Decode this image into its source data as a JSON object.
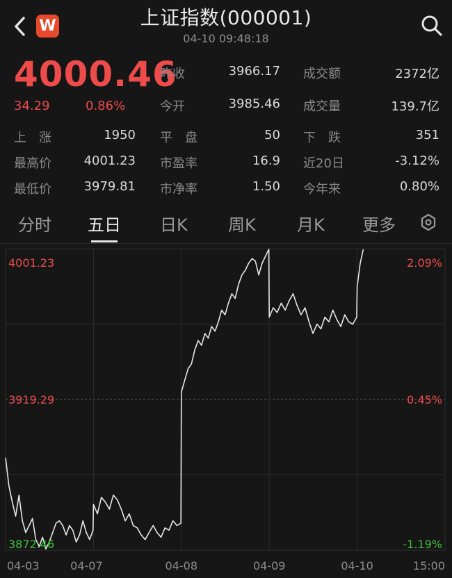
{
  "header": {
    "title": "上证指数(000001)",
    "timestamp": "04-10 09:48:18",
    "app_badge": "W"
  },
  "quote": {
    "price": "4000.46",
    "change": "34.29",
    "change_pct": "0.86%",
    "stats": [
      {
        "label": "昨收",
        "value": "3966.17"
      },
      {
        "label": "成交额",
        "value": "2372亿"
      },
      {
        "label": "今开",
        "value": "3985.46"
      },
      {
        "label": "成交量",
        "value": "139.7亿"
      },
      {
        "label": "上　涨",
        "value": "1950"
      },
      {
        "label": "平　盘",
        "value": "50"
      },
      {
        "label": "下　跌",
        "value": "351"
      },
      {
        "label": "最高价",
        "value": "4001.23"
      },
      {
        "label": "市盈率",
        "value": "16.9"
      },
      {
        "label": "近20日",
        "value": "-3.12%"
      },
      {
        "label": "最低价",
        "value": "3979.81"
      },
      {
        "label": "市净率",
        "value": "1.50"
      },
      {
        "label": "今年来",
        "value": "0.80%"
      }
    ]
  },
  "tabs": [
    {
      "label": "分时"
    },
    {
      "label": "五日"
    },
    {
      "label": "日K"
    },
    {
      "label": "周K"
    },
    {
      "label": "月K"
    },
    {
      "label": "更多"
    }
  ],
  "active_tab": "五日",
  "colors": {
    "up": "#ee4b4b",
    "down": "#3cc23c",
    "background": "#161616",
    "line": "#e8e8e8"
  },
  "chart_data": {
    "type": "line",
    "title": "",
    "x_labels": [
      "04-03",
      "04-07",
      "04-08",
      "04-09",
      "04-10",
      "15:00"
    ],
    "y_labels_left": [
      "4001.23",
      "3919.29",
      "3872.46"
    ],
    "y_labels_right": [
      "2.09%",
      "0.45%",
      "-1.19%"
    ],
    "ylim": [
      3872.46,
      4001.23
    ],
    "reference_value": 3919.29,
    "grid": true,
    "series": [
      {
        "values": [
          3912,
          3900,
          3893,
          3887,
          3896,
          3885,
          3880,
          3883,
          3886,
          3877,
          3874,
          3878,
          3873,
          3876,
          3880,
          3884,
          3885,
          3883,
          3879,
          3883,
          3881,
          3876,
          3879,
          3885,
          3880,
          3877,
          3881,
          3892,
          3888,
          3895,
          3893,
          3890,
          3896,
          3894,
          3890,
          3885,
          3888,
          3883,
          3882,
          3879,
          3877,
          3880,
          3883,
          3880,
          3878,
          3882,
          3881,
          3885,
          3883,
          3884,
          3940,
          3945,
          3950,
          3952,
          3958,
          3962,
          3960,
          3965,
          3963,
          3968,
          3966,
          3970,
          3975,
          3973,
          3978,
          3982,
          3980,
          3986,
          3990,
          3992,
          3995,
          3997,
          3996,
          3990,
          3995,
          3998,
          4001,
          3972,
          3976,
          3974,
          3978,
          3975,
          3979,
          3982,
          3977,
          3973,
          3976,
          3970,
          3965,
          3969,
          3967,
          3972,
          3970,
          3975,
          3971,
          3968,
          3973,
          3970,
          3969,
          3972,
          3985,
          3995,
          4001
        ]
      }
    ]
  }
}
